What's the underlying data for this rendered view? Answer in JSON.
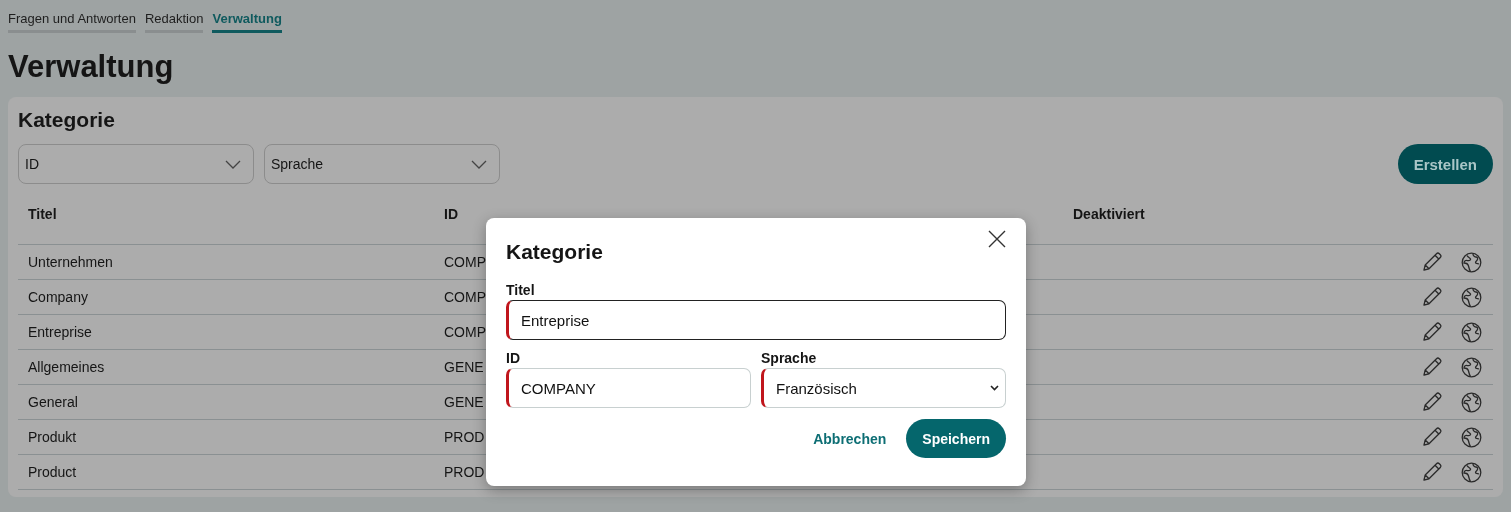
{
  "tabs": [
    {
      "label": "Fragen und Antworten",
      "selected": false
    },
    {
      "label": "Redaktion",
      "selected": false
    },
    {
      "label": "Verwaltung",
      "selected": true
    }
  ],
  "page_title": "Verwaltung",
  "card": {
    "title": "Kategorie",
    "filters": [
      {
        "placeholder": "ID"
      },
      {
        "placeholder": "Sprache"
      }
    ],
    "create_button": "Erstellen",
    "table": {
      "columns": [
        "Titel",
        "ID",
        "Deaktiviert"
      ],
      "rows": [
        [
          "Unternehmen",
          "COMP"
        ],
        [
          "Company",
          "COMP"
        ],
        [
          "Entreprise",
          "COMP"
        ],
        [
          "Allgemeines",
          "GENE"
        ],
        [
          "General",
          "GENE"
        ],
        [
          "Produkt",
          "PROD"
        ],
        [
          "Product",
          "PROD"
        ]
      ]
    }
  },
  "dialog": {
    "title": "Kategorie",
    "title_field": {
      "label": "Titel",
      "value": "Entreprise",
      "invalid": true
    },
    "id_field": {
      "label": "ID",
      "value": "COMPANY",
      "invalid": true
    },
    "language_field": {
      "label": "Sprache",
      "value": "Französisch",
      "invalid": true
    },
    "cancel": "Abbrechen",
    "save": "Speichern"
  }
}
